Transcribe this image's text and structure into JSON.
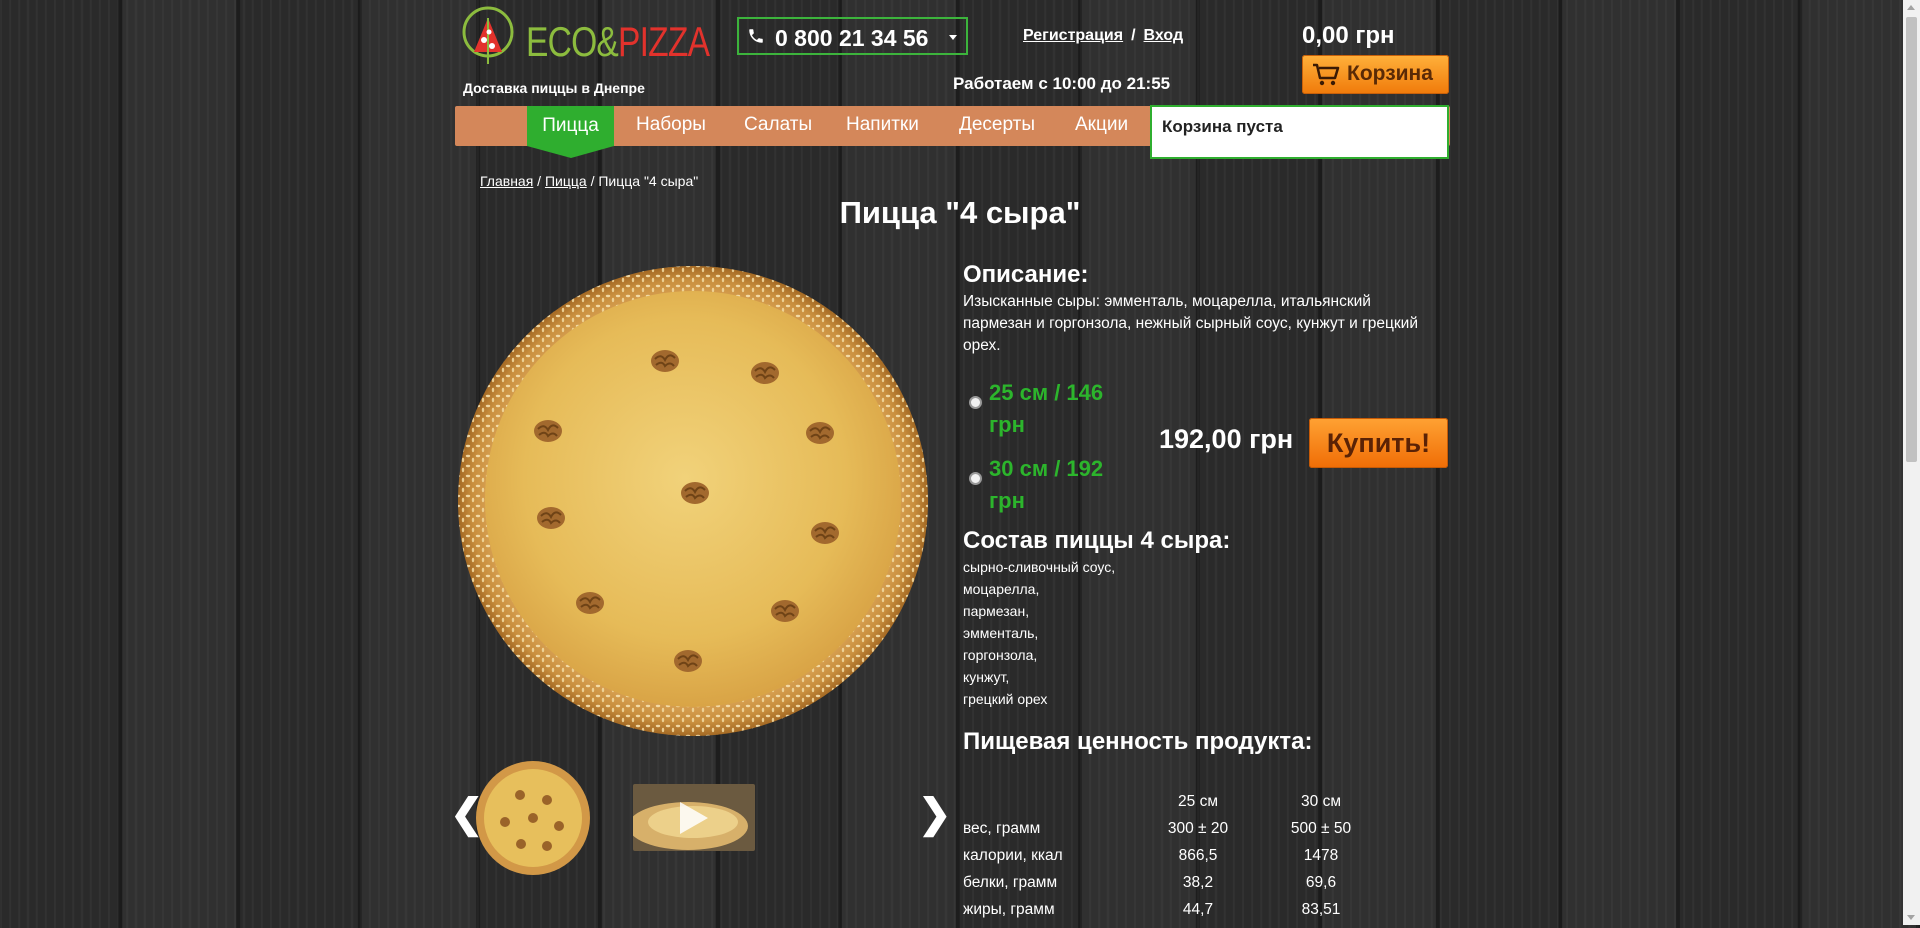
{
  "header": {
    "logo": {
      "part1": "ECO&",
      "part2": "PIZZA"
    },
    "tagline": "Доставка пиццы в Днепре",
    "phone": "0 800 21 34 56",
    "auth": {
      "register": "Регистрация",
      "separator": "/",
      "login": "Вход"
    },
    "hours": "Работаем с 10:00 до 21:55",
    "cart_total": "0,00 грн",
    "cart_button": "Корзина"
  },
  "nav": {
    "items": [
      {
        "label": "Пицца",
        "active": true
      },
      {
        "label": "Наборы"
      },
      {
        "label": "Салаты"
      },
      {
        "label": "Напитки"
      },
      {
        "label": "Десерты"
      },
      {
        "label": "Акции"
      }
    ],
    "cart_empty": "Корзина пуста"
  },
  "breadcrumb": {
    "home": "Главная",
    "sep1": " / ",
    "category": "Пицца",
    "sep2": " / ",
    "current": "Пицца \"4 сыра\""
  },
  "product": {
    "title": "Пицца \"4 сыра\"",
    "description_heading": "Описание:",
    "description": "Изысканные сыры:  эмменталь, моцарелла, итальянский пармезан и горгонзола, нежный сырный соус, кунжут и грецкий орех.",
    "sizes": [
      {
        "line1": "25 см / 146",
        "line2": "грн"
      },
      {
        "line1": "30 см / 192",
        "line2": "грн"
      }
    ],
    "price": "192,00 грн",
    "buy_button": "Купить!",
    "composition_heading": "Состав пиццы 4 сыра:",
    "composition": [
      "сырно-сливочный соус,",
      "моцарелла,",
      "пармезан,",
      "эмменталь,",
      "горгонзола,",
      "кунжут,",
      "грецкий орех"
    ],
    "nutrition_heading": "Пищевая ценность продукта:",
    "nutrition": {
      "columns": [
        "",
        "25 см",
        "30 см"
      ],
      "rows": [
        [
          "вес, грамм",
          "300 ± 20",
          "500 ± 50"
        ],
        [
          "калории, ккал",
          "866,5",
          "1478"
        ],
        [
          "белки, грамм",
          "38,2",
          "69,6"
        ],
        [
          "жиры, грамм",
          "44,7",
          "83,51"
        ]
      ]
    }
  },
  "gallery": {
    "prev": "❮",
    "next": "❯"
  },
  "colors": {
    "accent_green": "#2fae2f",
    "nav_bg": "#d4875a",
    "button_orange": "#f07a0a"
  }
}
